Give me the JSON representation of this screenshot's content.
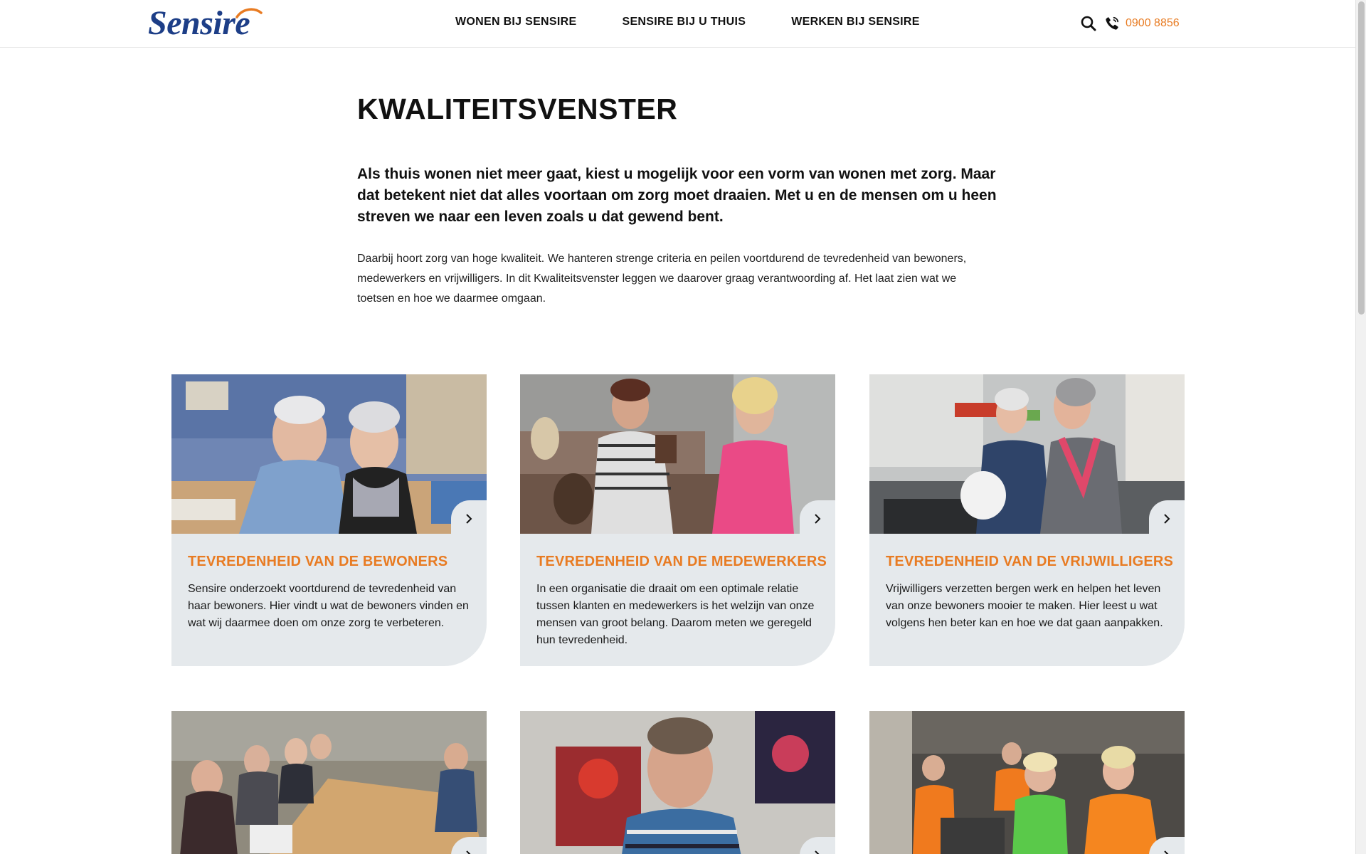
{
  "header": {
    "logo_text": "Sensire",
    "nav": [
      {
        "label": "WONEN BIJ SENSIRE"
      },
      {
        "label": "SENSIRE BIJ U THUIS"
      },
      {
        "label": "WERKEN BIJ SENSIRE"
      }
    ],
    "search_icon": "search-icon",
    "phone_icon": "phone-icon",
    "phone_number": "0900 8856"
  },
  "colors": {
    "accent": "#e87b22",
    "brand": "#1d3e87",
    "card_bg": "#e5e9ec"
  },
  "intro": {
    "title": "KWALITEITSVENSTER",
    "lead": "Als thuis wonen niet meer gaat, kiest u mogelijk voor een vorm van wonen met zorg. Maar dat betekent niet dat alles voortaan om zorg moet draaien. Met u en de mensen om u heen streven we naar een leven zoals u dat gewend bent.",
    "body": "Daarbij hoort zorg van hoge kwaliteit. We hanteren strenge criteria en peilen voortdurend de tevredenheid van bewoners, medewerkers en vrijwilligers. In dit Kwaliteitsvenster leggen we daarover graag verantwoording af. Het laat zien wat we toetsen en hoe we daarmee omgaan."
  },
  "cards": [
    {
      "title": "TEVREDENHEID VAN DE BEWONERS",
      "description": "Sensire onderzoekt voortdurend de tevredenheid van haar bewoners. Hier vindt u wat de bewoners vinden en wat wij daarmee doen om onze zorg te verbeteren."
    },
    {
      "title": "TEVREDENHEID VAN DE MEDEWERKERS",
      "description": "In een organisatie die draait om een optimale relatie tussen klanten en medewerkers is het welzijn van onze mensen van groot belang. Daarom meten we geregeld hun tevredenheid."
    },
    {
      "title": "TEVREDENHEID VAN DE VRIJWILLIGERS",
      "description": "Vrijwilligers verzetten bergen werk en helpen het leven van onze bewoners mooier te maken. Hier leest u wat volgens hen beter kan en hoe we dat gaan aanpakken."
    },
    {
      "title": "",
      "description": ""
    },
    {
      "title": "",
      "description": ""
    },
    {
      "title": "",
      "description": ""
    }
  ]
}
